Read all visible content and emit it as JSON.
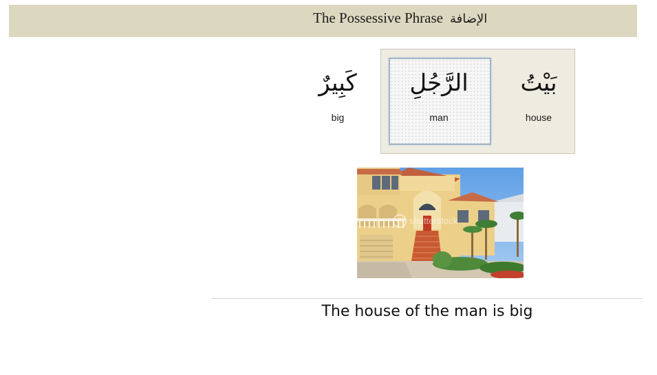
{
  "header": {
    "title": "The Possessive Phrase",
    "arabic_title": "الإضافة"
  },
  "phrase": {
    "words": [
      {
        "arabic": "بَيْتُ",
        "english": "house"
      },
      {
        "arabic": "الرَّجُلِ",
        "english": "man"
      },
      {
        "arabic": "كَبِيرٌ",
        "english": "big"
      }
    ]
  },
  "image": {
    "subject": "house-photo",
    "watermark": "shutterstock"
  },
  "sentence": "The house of the man is big",
  "colors": {
    "header_bar": "#dcd8c0",
    "panel": "#eeebe0",
    "highlight_border": "#9fb3c8"
  }
}
